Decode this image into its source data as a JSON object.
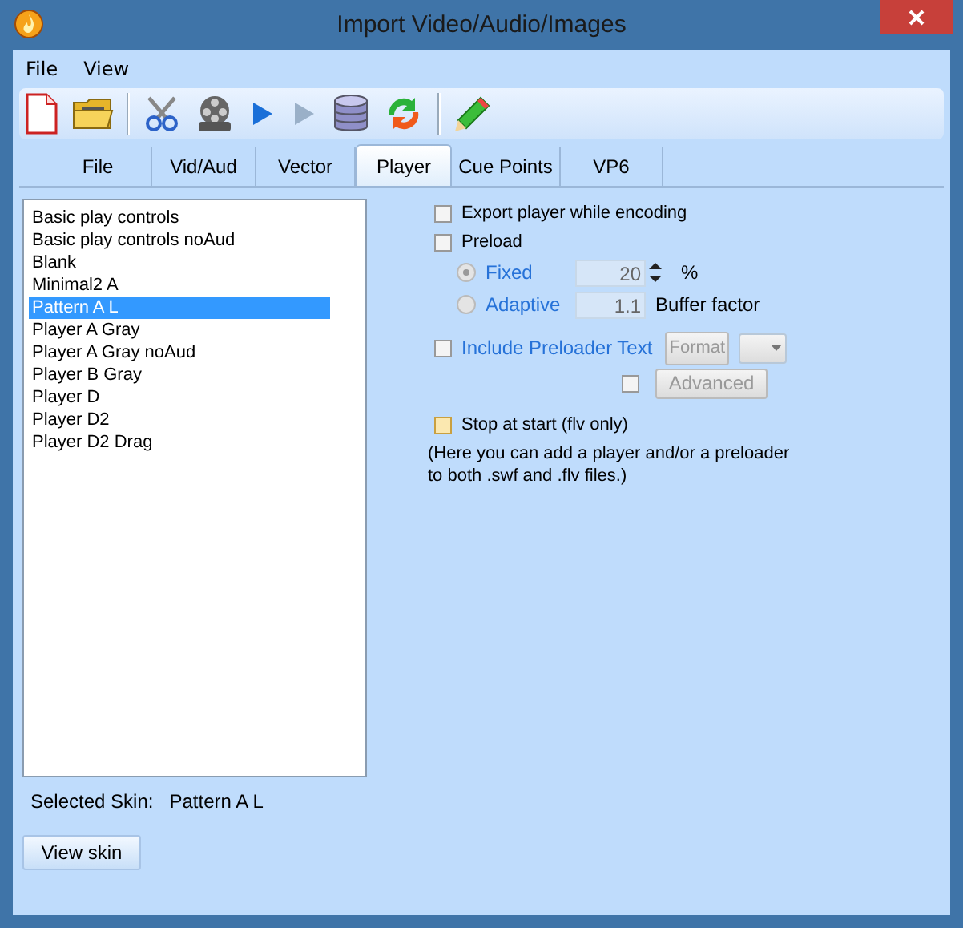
{
  "window": {
    "title": "Import Video/Audio/Images"
  },
  "menu": [
    "File",
    "View"
  ],
  "toolbar": [
    {
      "kind": "new",
      "disabled": false
    },
    {
      "kind": "open",
      "disabled": false
    },
    {
      "kind": "cut",
      "disabled": false
    },
    {
      "kind": "reel",
      "disabled": false
    },
    {
      "kind": "play",
      "disabled": false
    },
    {
      "kind": "play",
      "disabled": true
    },
    {
      "kind": "database",
      "disabled": false
    },
    {
      "kind": "refresh",
      "disabled": false
    },
    {
      "kind": "pencil",
      "disabled": false
    }
  ],
  "tabs": [
    {
      "label": "File",
      "selected": false
    },
    {
      "label": "Vid/Aud",
      "selected": false
    },
    {
      "label": "Vector",
      "selected": false
    },
    {
      "label": "Player",
      "selected": true
    },
    {
      "label": "Cue Points",
      "selected": false
    },
    {
      "label": "VP6",
      "selected": false
    }
  ],
  "skins": [
    {
      "label": "Basic play controls",
      "selected": false
    },
    {
      "label": "Basic play controls noAud",
      "selected": false
    },
    {
      "label": "Blank",
      "selected": false
    },
    {
      "label": "Minimal2 A",
      "selected": false
    },
    {
      "label": "Pattern A L",
      "selected": true
    },
    {
      "label": "Player A Gray",
      "selected": false
    },
    {
      "label": "Player A Gray noAud",
      "selected": false
    },
    {
      "label": "Player B Gray",
      "selected": false
    },
    {
      "label": "Player D",
      "selected": false
    },
    {
      "label": "Player D2",
      "selected": false
    },
    {
      "label": "Player D2 Drag",
      "selected": false
    }
  ],
  "selected_skin": {
    "label": "Selected Skin:",
    "value": "Pattern A L"
  },
  "view_button": "View skin",
  "export_player": {
    "label": "Export player while encoding",
    "checked": false
  },
  "preload": {
    "label": "Preload",
    "checked": false
  },
  "buffer_modes": [
    {
      "label": "Fixed",
      "selected": true,
      "value": "20",
      "unit": "%",
      "spinner": true
    },
    {
      "label": "Adaptive",
      "selected": false,
      "value": "1.1",
      "unit": "Buffer factor",
      "spinner": false
    }
  ],
  "preloader_text": {
    "label": "Include Preloader Text",
    "checked": false,
    "button": "Format"
  },
  "advanced": {
    "checked": false,
    "button": "Advanced"
  },
  "stop_at_start": {
    "label": "Stop at start (flv only)",
    "checked": false
  },
  "note": "(Here you can add a player and/or a preloader to both .swf and .flv files.)"
}
